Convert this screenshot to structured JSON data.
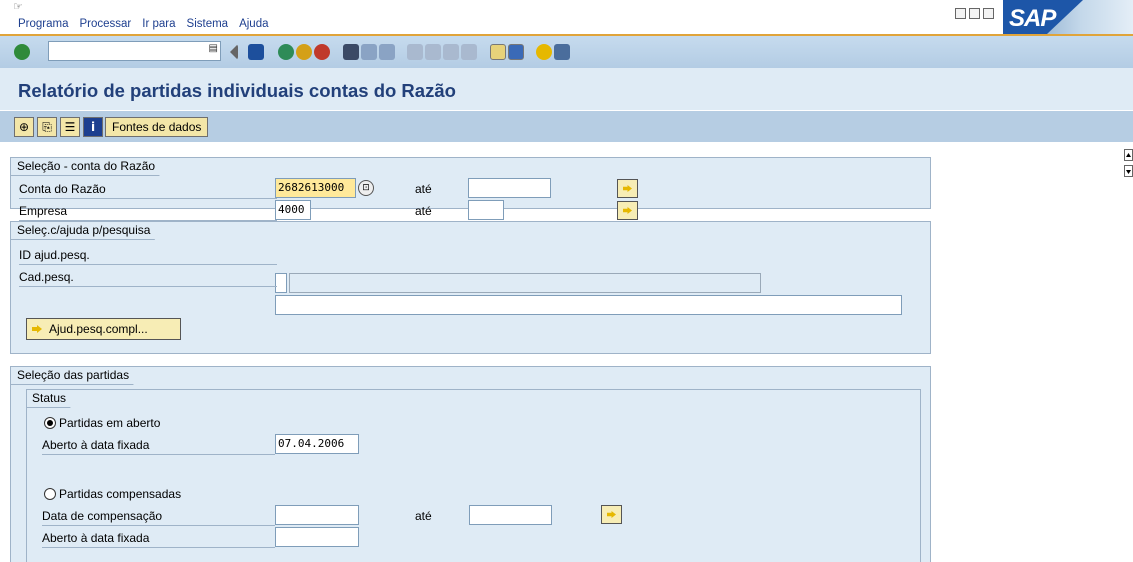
{
  "menu": {
    "items": [
      "Programa",
      "Processar",
      "Ir para",
      "Sistema",
      "Ajuda"
    ]
  },
  "toolbar": {
    "ok_code_value": "",
    "icons": [
      "enter-icon",
      "back-icon",
      "save-icon",
      "back-icon",
      "exit-icon",
      "cancel-icon",
      "print-icon",
      "find-icon",
      "find-next-icon",
      "first-page-icon",
      "previous-page-icon",
      "next-page-icon",
      "last-page-icon",
      "create-session-icon",
      "shortcut-icon",
      "help-icon",
      "customize-icon"
    ]
  },
  "page": {
    "title": "Relatório de partidas individuais contas do Razão"
  },
  "app_toolbar": {
    "fontes_label": "Fontes de dados",
    "icons": [
      "execute-icon",
      "get-variant-icon",
      "selection-options-icon",
      "info-icon"
    ]
  },
  "group1": {
    "title": "Seleção - conta do Razão",
    "conta_label": "Conta do Razão",
    "conta_value": "2682613000",
    "empresa_label": "Empresa",
    "empresa_value": "4000",
    "ate1": "até",
    "ate2": "até"
  },
  "group2": {
    "title": "Seleç.c/ajuda p/pesquisa",
    "id_label": "ID ajud.pesq.",
    "cad_label": "Cad.pesq.",
    "btn_label": "Ajud.pesq.compl..."
  },
  "group3": {
    "title": "Seleção das partidas",
    "status_title": "Status",
    "radio_open": "Partidas em aberto",
    "aberto_label": "Aberto à data fixada",
    "aberto_value": "07.04.2006",
    "radio_comp": "Partidas compensadas",
    "data_comp_label": "Data de compensação",
    "ate": "até",
    "aberto_label2": "Aberto à data fixada"
  },
  "colors": {
    "title": "#22407a",
    "toolbar": "#b6cde3",
    "panel": "#dfebf5",
    "focus_field": "#ffe99a",
    "menu_text": "#1e3f8f"
  }
}
